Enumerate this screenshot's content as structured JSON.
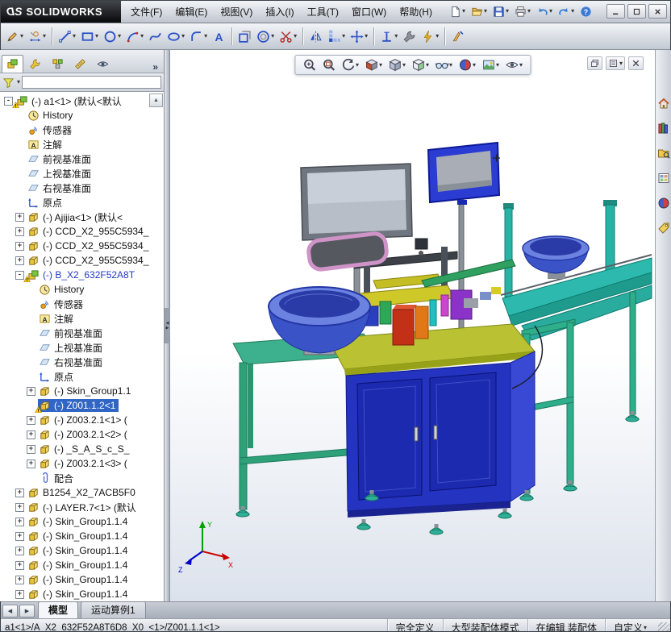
{
  "colors": {
    "selection": "#3166c4",
    "warning": "#ffd000",
    "viewport-top": "#ffffff",
    "viewport-bottom": "#dce2ec",
    "cabinet-blue": "#2433c0",
    "tabletop-green": "#bac233",
    "frame-green": "#3db08d",
    "conveyor-teal": "#2db9ad",
    "bowl-blue": "#3a54c8"
  },
  "titlebar": {
    "brand_mark_left": "D",
    "brand_mark_right": "S",
    "brand": "SOLIDWORKS",
    "menus": [
      {
        "name": "file",
        "label": "文件(F)"
      },
      {
        "name": "edit",
        "label": "编辑(E)"
      },
      {
        "name": "view",
        "label": "视图(V)"
      },
      {
        "name": "insert",
        "label": "插入(I)"
      },
      {
        "name": "tools",
        "label": "工具(T)"
      },
      {
        "name": "window",
        "label": "窗口(W)"
      },
      {
        "name": "help",
        "label": "帮助(H)"
      }
    ],
    "quick_tools": [
      {
        "name": "new-document",
        "caret": true
      },
      {
        "name": "open",
        "caret": true
      },
      {
        "name": "save",
        "caret": true
      },
      {
        "name": "print",
        "caret": true
      },
      {
        "name": "undo",
        "caret": true
      },
      {
        "name": "redo",
        "caret": true
      },
      {
        "name": "help",
        "caret": false
      }
    ],
    "window_controls": [
      {
        "name": "minimize"
      },
      {
        "name": "maximize"
      },
      {
        "name": "close"
      }
    ]
  },
  "sketch_toolbar": {
    "tools": [
      {
        "name": "sketch",
        "caret": true
      },
      {
        "name": "smart-dimension",
        "caret": true
      },
      {
        "name": "line",
        "caret": true,
        "sep": true
      },
      {
        "name": "rectangle",
        "caret": true
      },
      {
        "name": "circle",
        "caret": true
      },
      {
        "name": "arc",
        "caret": true
      },
      {
        "name": "spline",
        "caret": false
      },
      {
        "name": "ellipse",
        "caret": true
      },
      {
        "name": "sketch-fillet",
        "caret": true
      },
      {
        "name": "sketch-text",
        "caret": false
      },
      {
        "name": "convert-entities",
        "caret": false,
        "sep": true
      },
      {
        "name": "offset-entities",
        "caret": true
      },
      {
        "name": "trim-entities",
        "caret": true
      },
      {
        "name": "mirror-entities",
        "caret": false,
        "sep": true
      },
      {
        "name": "linear-sketch-pattern",
        "caret": true
      },
      {
        "name": "move-entities",
        "caret": true
      },
      {
        "name": "display-relations",
        "caret": true,
        "sep": true
      },
      {
        "name": "repair-sketch",
        "caret": false
      },
      {
        "name": "quick-snaps",
        "caret": true
      },
      {
        "name": "rapid-sketch",
        "caret": false,
        "sep": true
      }
    ]
  },
  "feature_panel": {
    "tabs": [
      {
        "name": "featuremanager",
        "active": true
      },
      {
        "name": "propertymanager",
        "active": false
      },
      {
        "name": "configurationmanager",
        "active": false
      },
      {
        "name": "dimxpertmanager",
        "active": false
      },
      {
        "name": "displaymanager",
        "active": false
      }
    ],
    "overflow": "»",
    "filter_value": "",
    "scroll_up": "▲"
  },
  "tree": {
    "items": [
      {
        "label": "(-) a1<1> (默认<默认",
        "icon": "assembly",
        "level": 0,
        "expand": "minus",
        "warn": true
      },
      {
        "label": "History",
        "icon": "history",
        "level": 1
      },
      {
        "label": "传感器",
        "icon": "sensors",
        "level": 1
      },
      {
        "label": "注解",
        "icon": "annotations",
        "level": 1
      },
      {
        "label": "前视基准面",
        "icon": "plane",
        "level": 1
      },
      {
        "label": "上视基准面",
        "icon": "plane",
        "level": 1
      },
      {
        "label": "右视基准面",
        "icon": "plane",
        "level": 1
      },
      {
        "label": "原点",
        "icon": "origin",
        "level": 1
      },
      {
        "label": "(-) Ajijia<1> (默认<",
        "icon": "part",
        "level": 1,
        "expand": "plus"
      },
      {
        "label": "(-) CCD_X2_955C5934_",
        "icon": "part",
        "level": 1,
        "expand": "plus"
      },
      {
        "label": "(-) CCD_X2_955C5934_",
        "icon": "part",
        "level": 1,
        "expand": "plus"
      },
      {
        "label": "(-) CCD_X2_955C5934_",
        "icon": "part",
        "level": 1,
        "expand": "plus"
      },
      {
        "label": "(-) B_X2_632F52A8T",
        "icon": "assembly",
        "level": 1,
        "expand": "minus",
        "warn": true,
        "edited": true
      },
      {
        "label": "History",
        "icon": "history",
        "level": 2
      },
      {
        "label": "传感器",
        "icon": "sensors",
        "level": 2
      },
      {
        "label": "注解",
        "icon": "annotations",
        "level": 2
      },
      {
        "label": "前视基准面",
        "icon": "plane",
        "level": 2
      },
      {
        "label": "上视基准面",
        "icon": "plane",
        "level": 2
      },
      {
        "label": "右视基准面",
        "icon": "plane",
        "level": 2
      },
      {
        "label": "原点",
        "icon": "origin",
        "level": 2
      },
      {
        "label": "(-) Skin_Group1.1",
        "icon": "part",
        "level": 2,
        "expand": "plus"
      },
      {
        "label": "(-) Z001.1.2<1",
        "icon": "part",
        "level": 2,
        "warn": true,
        "selected": true
      },
      {
        "label": "(-) Z003.2.1<1> (",
        "icon": "part",
        "level": 2,
        "expand": "plus"
      },
      {
        "label": "(-) Z003.2.1<2> (",
        "icon": "part",
        "level": 2,
        "expand": "plus"
      },
      {
        "label": "(-) _S_A_S_c_S_",
        "icon": "part",
        "level": 2,
        "expand": "plus"
      },
      {
        "label": "(-) Z003.2.1<3> (",
        "icon": "part",
        "level": 2,
        "expand": "plus"
      },
      {
        "label": "配合",
        "icon": "mates",
        "level": 2
      },
      {
        "label": "B1254_X2_7ACB5F0",
        "icon": "part",
        "level": 1,
        "expand": "plus"
      },
      {
        "label": "(-) LAYER.7<1> (默认",
        "icon": "part",
        "level": 1,
        "expand": "plus"
      },
      {
        "label": "(-) Skin_Group1.1.4",
        "icon": "part",
        "level": 1,
        "expand": "plus"
      },
      {
        "label": "(-) Skin_Group1.1.4",
        "icon": "part",
        "level": 1,
        "expand": "plus"
      },
      {
        "label": "(-) Skin_Group1.1.4",
        "icon": "part",
        "level": 1,
        "expand": "plus"
      },
      {
        "label": "(-) Skin_Group1.1.4",
        "icon": "part",
        "level": 1,
        "expand": "plus"
      },
      {
        "label": "(-) Skin_Group1.1.4",
        "icon": "part",
        "level": 1,
        "expand": "plus"
      },
      {
        "label": "(-) Skin_Group1.1.4",
        "icon": "part",
        "level": 1,
        "expand": "plus"
      }
    ]
  },
  "viewport": {
    "hud_tools": [
      {
        "name": "zoom-fit"
      },
      {
        "name": "zoom-area"
      },
      {
        "name": "previous-view",
        "caret": true
      },
      {
        "name": "section-view",
        "caret": true
      },
      {
        "name": "view-orientation",
        "caret": true
      },
      {
        "name": "display-style",
        "caret": true
      },
      {
        "name": "hide-show-items",
        "caret": true
      },
      {
        "name": "edit-appearance",
        "caret": true
      },
      {
        "name": "apply-scene",
        "caret": true
      },
      {
        "name": "view-settings",
        "caret": true
      }
    ],
    "doc_buttons": [
      {
        "name": "restore-document"
      },
      {
        "name": "document-menu",
        "caret": true
      },
      {
        "name": "close-document"
      }
    ],
    "triad": {
      "x": "X",
      "y": "Y",
      "z": "Z"
    }
  },
  "taskpane": {
    "icons": [
      {
        "name": "resources-home"
      },
      {
        "name": "design-library"
      },
      {
        "name": "file-explorer"
      },
      {
        "name": "view-palette"
      },
      {
        "name": "appearances"
      },
      {
        "name": "custom-properties"
      }
    ]
  },
  "tabs": {
    "scroll_left": "◀",
    "scroll_right": "▶",
    "items": [
      {
        "name": "model",
        "label": "模型",
        "active": true
      },
      {
        "name": "motion-study-1",
        "label": "运动算例1",
        "active": false
      }
    ]
  },
  "status": {
    "path": "a1<1>/A_X2_632F52A8T6D8_X0_<1>/Z001.1.1<1>",
    "fields": [
      {
        "name": "status-defined",
        "label": "完全定义"
      },
      {
        "name": "status-assembly-mode",
        "label": "大型装配体模式"
      },
      {
        "name": "status-editing",
        "label": "在编辑 装配体"
      },
      {
        "name": "status-units",
        "label": "自定义",
        "caret": true
      }
    ]
  }
}
